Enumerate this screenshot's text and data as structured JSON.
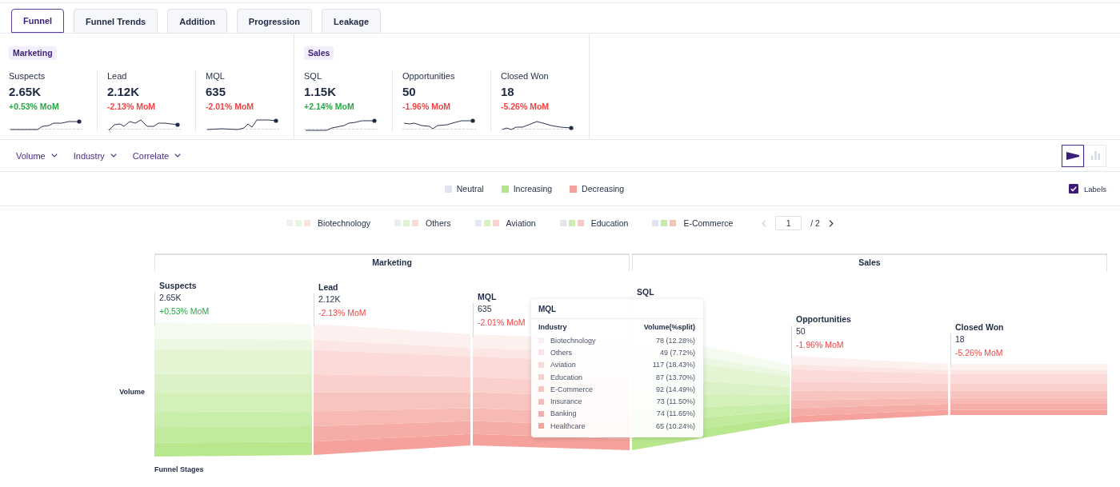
{
  "tabs": [
    {
      "label": "Funnel",
      "selected": true
    },
    {
      "label": "Funnel Trends",
      "selected": false
    },
    {
      "label": "Addition",
      "selected": false
    },
    {
      "label": "Progression",
      "selected": false
    },
    {
      "label": "Leakage",
      "selected": false
    }
  ],
  "kpi_groups": [
    {
      "label": "Marketing",
      "metrics": [
        {
          "name": "Suspects",
          "value": "2.65K",
          "change": "+0.53% MoM",
          "increasing": true
        },
        {
          "name": "Lead",
          "value": "2.12K",
          "change": "-2.13% MoM",
          "increasing": false
        },
        {
          "name": "MQL",
          "value": "635",
          "change": "-2.01% MoM",
          "increasing": false
        }
      ]
    },
    {
      "label": "Sales",
      "metrics": [
        {
          "name": "SQL",
          "value": "1.15K",
          "change": "+2.14% MoM",
          "increasing": true
        },
        {
          "name": "Opportunities",
          "value": "50",
          "change": "-1.96% MoM",
          "increasing": false
        },
        {
          "name": "Closed Won",
          "value": "18",
          "change": "-5.26% MoM",
          "increasing": false
        }
      ]
    }
  ],
  "filters": [
    {
      "label": "Volume"
    },
    {
      "label": "Industry"
    },
    {
      "label": "Correlate"
    }
  ],
  "view_toggle": [
    {
      "kind": "funnel",
      "selected": true
    },
    {
      "kind": "bar",
      "selected": false
    }
  ],
  "trend_legend": [
    {
      "label": "Neutral",
      "color": "#dfe4ec"
    },
    {
      "label": "Increasing",
      "color": "#b3e68c"
    },
    {
      "label": "Decreasing",
      "color": "#f4a19b"
    }
  ],
  "labels_toggle": {
    "label": "Labels",
    "checked": true
  },
  "industry_legend": {
    "items": [
      {
        "label": "Biotechnology",
        "swatches": [
          {
            "color": "#eceff4"
          },
          {
            "color": "#e6f5db"
          },
          {
            "color": "#fbe3e1"
          }
        ]
      },
      {
        "label": "Others",
        "swatches": [
          {
            "color": "#e9ecf2"
          },
          {
            "color": "#def3cf"
          },
          {
            "color": "#fadbd8"
          }
        ]
      },
      {
        "label": "Aviation",
        "swatches": [
          {
            "color": "#e6e9ef"
          },
          {
            "color": "#d6f0c3"
          },
          {
            "color": "#f9d2cf"
          }
        ]
      },
      {
        "label": "Education",
        "swatches": [
          {
            "color": "#e3e7ed"
          },
          {
            "color": "#ceedb7"
          },
          {
            "color": "#f8cac6"
          }
        ]
      },
      {
        "label": "E-Commerce",
        "swatches": [
          {
            "color": "#e0e4eb"
          },
          {
            "color": "#c6eaa9"
          },
          {
            "color": "#f7c1bc"
          }
        ]
      }
    ],
    "pagination": {
      "prev": {
        "disabled": true
      },
      "page": "1",
      "total": "/ 2",
      "next": {
        "disabled": false
      }
    }
  },
  "chart": {
    "y_label": "Volume",
    "groups": [
      {
        "label": "Marketing",
        "stages": [
          {
            "name": "Suspects",
            "value": "2.65K",
            "change": "+0.53% MoM",
            "increasing": true
          },
          {
            "name": "Lead",
            "value": "2.12K",
            "change": "-2.13% MoM",
            "increasing": false
          },
          {
            "name": "MQL",
            "value": "635",
            "change": "-2.01% MoM",
            "increasing": false
          }
        ]
      },
      {
        "label": "Sales",
        "stages": [
          {
            "name": "SQL",
            "increasing": true
          },
          {
            "name": "Opportunities",
            "value": "50",
            "change": "-1.96% MoM",
            "increasing": false
          },
          {
            "name": "Closed Won",
            "value": "18",
            "change": "-5.26% MoM",
            "increasing": false
          }
        ]
      }
    ],
    "tooltip": {
      "title": "MQL",
      "columns": [
        "Industry",
        "Volume(%split)"
      ],
      "rows": [
        {
          "industry": "Biotechnology",
          "value": "78 (12.28%)",
          "color": "#fdeeee"
        },
        {
          "industry": "Others",
          "value": "49 (7.72%)",
          "color": "#fce3e2"
        },
        {
          "industry": "Aviation",
          "value": "117 (18.43%)",
          "color": "#fbd9d7"
        },
        {
          "industry": "Education",
          "value": "87 (13.70%)",
          "color": "#f9cfcc"
        },
        {
          "industry": "E-Commerce",
          "value": "92 (14.49%)",
          "color": "#f8c5c1"
        },
        {
          "industry": "Insurance",
          "value": "73 (11.50%)",
          "color": "#f6b9b5"
        },
        {
          "industry": "Banking",
          "value": "74 (11.65%)",
          "color": "#f5aea9"
        },
        {
          "industry": "Healthcare",
          "value": "65 (10.24%)",
          "color": "#f3a29c"
        }
      ]
    },
    "x_label": "Funnel Stages"
  }
}
